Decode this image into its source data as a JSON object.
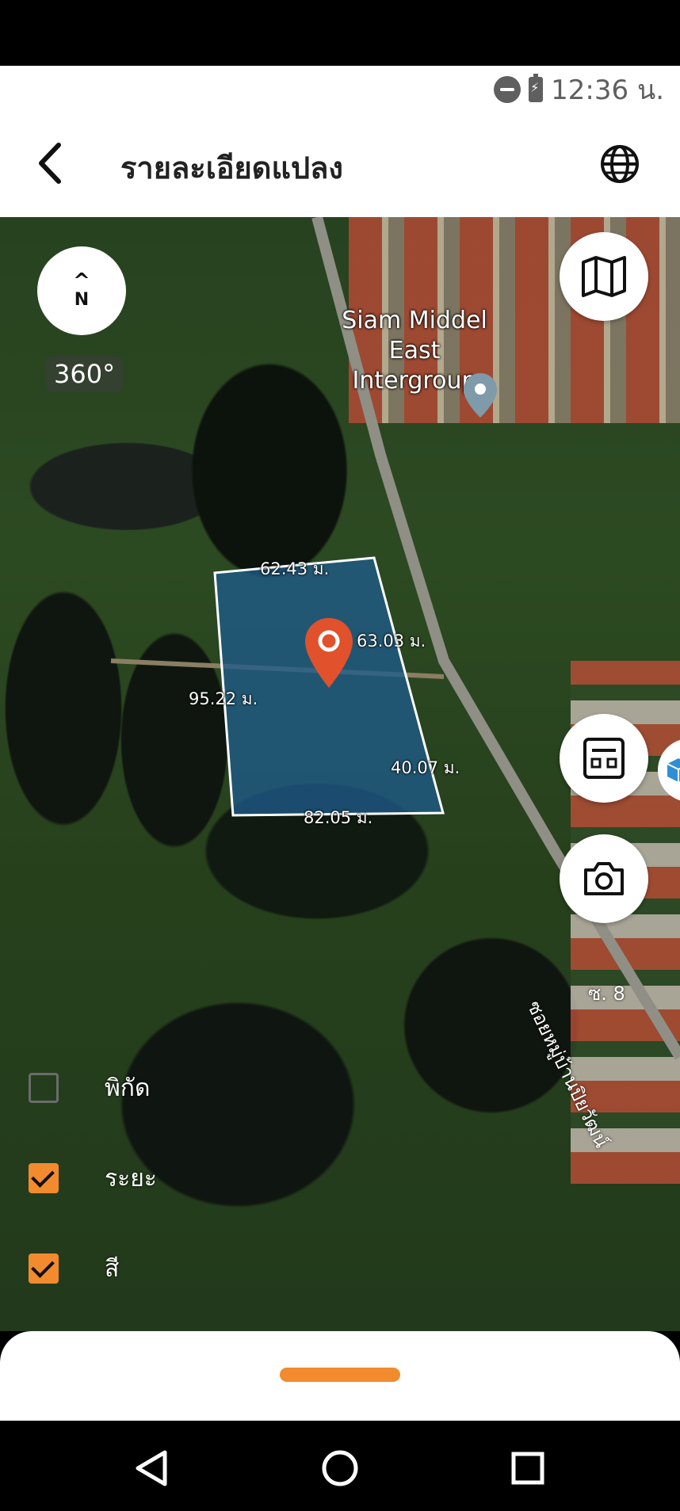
{
  "status_bar": {
    "time": "12:36 น."
  },
  "app_bar": {
    "title": "รายละเอียดแปลง"
  },
  "map": {
    "compass_letter": "N",
    "compass_arrow": "^",
    "panorama_label": "360°",
    "place": {
      "line1": "Siam Middel",
      "line2": "East Intergroup"
    },
    "measurements": {
      "top": "62.43 ม.",
      "right_upper": "63.03 ม.",
      "left": "95.22 ม.",
      "right_lower": "40.07 ม.",
      "bottom": "82.05 ม."
    },
    "road_label": "ซอยหมู่บ้านปิยวัฒน์",
    "soi_label": "ซ. 8"
  },
  "layers": [
    {
      "label": "พิกัด",
      "checked": false
    },
    {
      "label": "ระยะ",
      "checked": true
    },
    {
      "label": "สี",
      "checked": true
    }
  ],
  "colors": {
    "accent": "#f28a2e",
    "parcel_fill": "#1f5b8a",
    "pin": "#e0512c"
  },
  "icons": [
    "back-arrow-icon",
    "globe-icon",
    "map-icon",
    "calculator-icon",
    "camera-icon",
    "cube-icon",
    "nav-back-icon",
    "nav-home-icon",
    "nav-recents-icon"
  ]
}
